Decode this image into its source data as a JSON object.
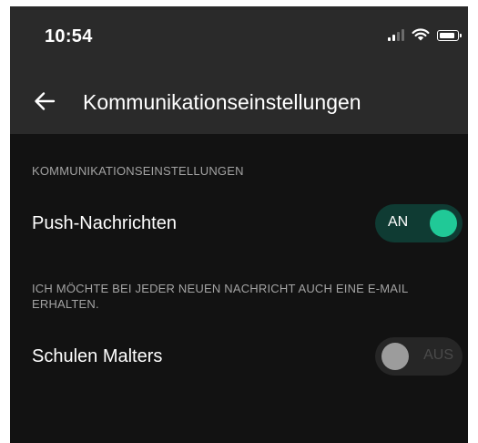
{
  "status_bar": {
    "time": "10:54",
    "icons": [
      "cellular-signal-icon",
      "wifi-icon",
      "battery-icon"
    ]
  },
  "app_bar": {
    "back_icon": "arrow-left-icon",
    "title": "Kommunikationseinstellungen"
  },
  "section": {
    "header": "KOMMUNIKATIONSEINSTELLUNGEN"
  },
  "push": {
    "label": "Push-Nachrichten",
    "toggle_text": "AN",
    "state": "on"
  },
  "email": {
    "hint": "ICH MÖCHTE BEI JEDER NEUEN NACHRICHT AUCH EINE E-MAIL ERHALTEN.",
    "label": "Schulen Malters",
    "toggle_text": "AUS",
    "state": "off"
  },
  "colors": {
    "background": "#121212",
    "app_bar": "#2a2a2a",
    "accent": "#20c997",
    "toggle_on_track": "#0f3b33",
    "muted_text": "#a3a3a3"
  }
}
